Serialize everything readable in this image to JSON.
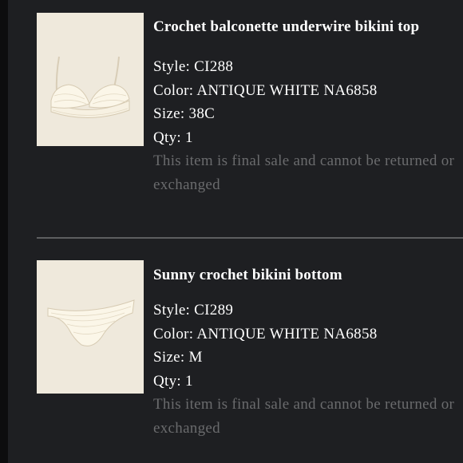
{
  "items": [
    {
      "title": "Crochet balconette underwire bikini top",
      "style": "Style: CI288",
      "color": "Color: ANTIQUE WHITE NA6858",
      "size": "Size: 38C",
      "qty": "Qty: 1",
      "note": "This item is final sale and cannot be returned or exchanged",
      "image": "crochet-bikini-top"
    },
    {
      "title": "Sunny crochet bikini bottom",
      "style": "Style: CI289",
      "color": "Color: ANTIQUE WHITE NA6858",
      "size": "Size: M",
      "qty": "Qty: 1",
      "note": "This item is final sale and cannot be returned or exchanged",
      "image": "crochet-bikini-bottom"
    }
  ],
  "colors": {
    "background": "#1e1f22",
    "text": "#ffffff",
    "muted_text": "#6a6b6d",
    "divider": "#5d5e60",
    "thumbnail_bg": "#efe9dc"
  }
}
